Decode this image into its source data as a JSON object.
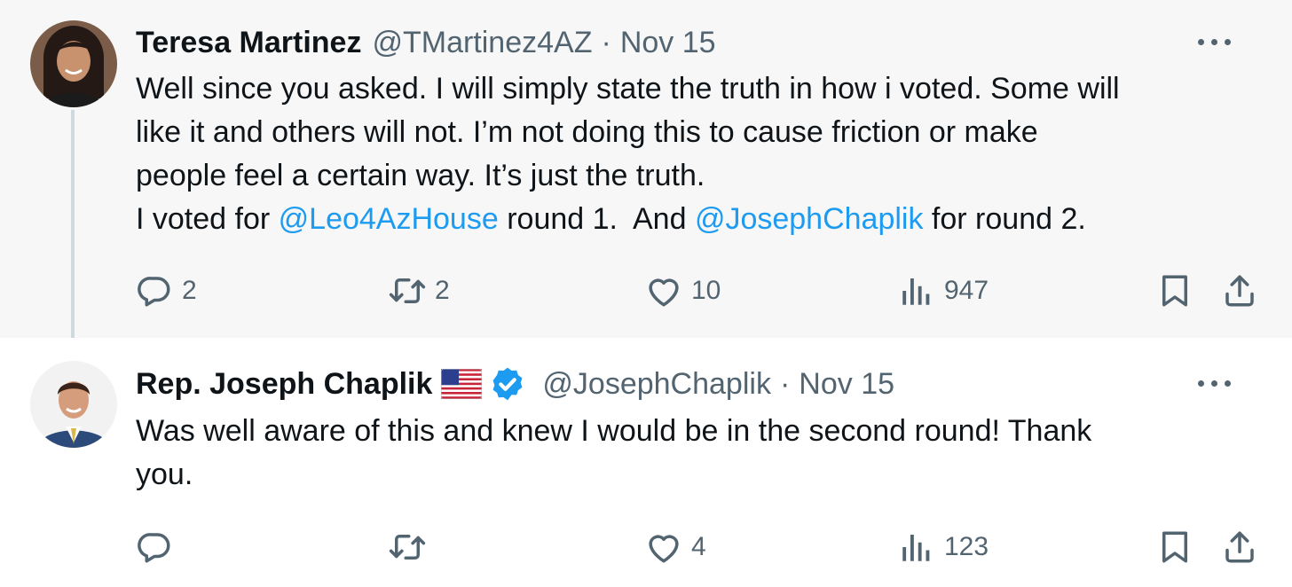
{
  "tweets": [
    {
      "name": "Teresa Martinez",
      "handle": "@TMartinez4AZ",
      "separator": "·",
      "date": "Nov 15",
      "avatar_icon": "avatar-woman-dark-curly-hair",
      "verified": false,
      "flag": false,
      "body": {
        "line1": "Well since you asked.  I will simply state the truth in how i voted.  Some will",
        "line2": "like it and others will not.  I’m not doing this to cause friction or make",
        "line3": "people feel a certain way.  It’s just the truth.",
        "line4_before": "I voted for ",
        "mention1": "@Leo4AzHouse",
        "line4_middle": " round 1.  And ",
        "mention2": "@JosephChaplik",
        "line4_after": " for round 2."
      },
      "stats": {
        "replies": "2",
        "reposts": "2",
        "likes": "10",
        "views": "947"
      }
    },
    {
      "name": "Rep. Joseph Chaplik",
      "handle": "@JosephChaplik",
      "separator": "·",
      "date": "Nov 15",
      "avatar_icon": "avatar-man-suit",
      "verified": true,
      "flag": true,
      "body": {
        "line1": "Was well aware of this and knew I would be in the second round!  Thank",
        "line2": "you."
      },
      "stats": {
        "replies": "",
        "reposts": "",
        "likes": "4",
        "views": "123"
      }
    }
  ],
  "icons": {
    "reply": "reply-icon",
    "repost": "repost-icon",
    "like": "heart-icon",
    "views": "views-icon",
    "bookmark": "bookmark-icon",
    "share": "share-icon",
    "more": "more-icon",
    "verified": "verified-badge-icon",
    "flag": "us-flag-icon"
  },
  "colors": {
    "mention": "#1d9bf0",
    "verified": "#1d9bf0",
    "muted": "#536471",
    "thread_line": "#cfd9de"
  }
}
